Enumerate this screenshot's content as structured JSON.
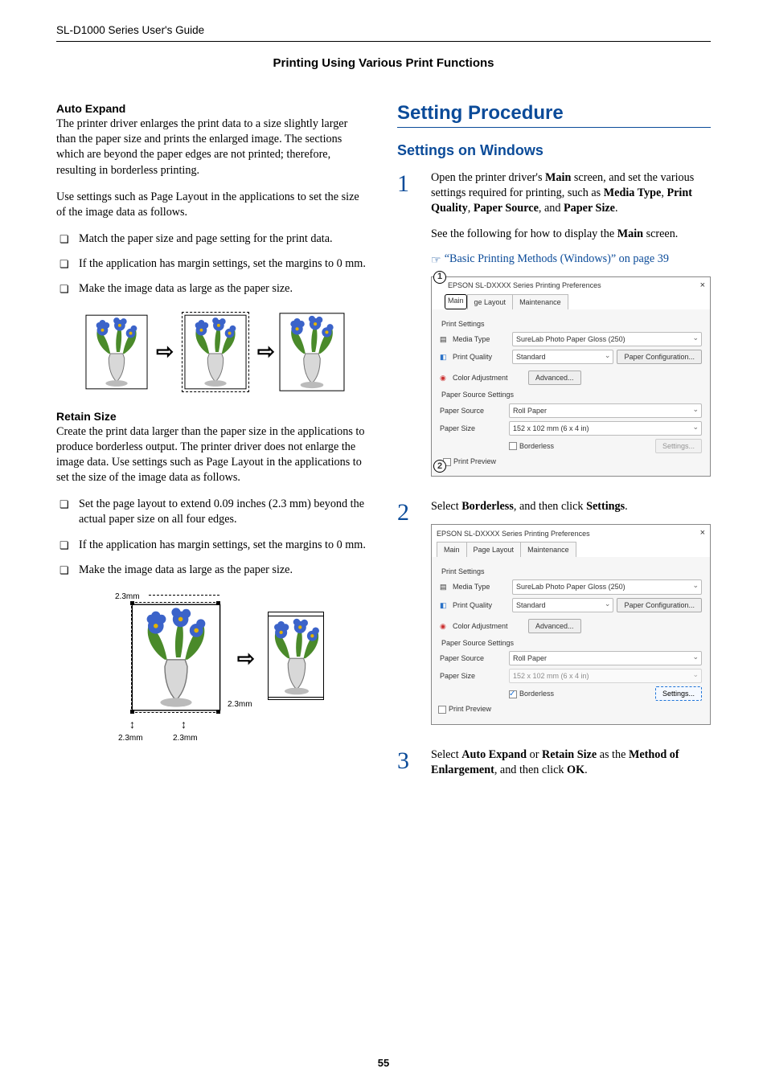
{
  "header": {
    "breadcrumb": "SL-D1000 Series User's Guide",
    "section": "Printing Using Various Print Functions"
  },
  "left": {
    "auto_head": "Auto Expand",
    "auto_body": "The printer driver enlarges the print data to a size slightly larger than the paper size and prints the enlarged image. The sections which are beyond the paper edges are not printed; therefore, resulting in borderless printing.",
    "auto_body2": "Use settings such as Page Layout in the applications to set the size of the image data as follows.",
    "auto_bullets": [
      "Match the paper size and page setting for the print data.",
      "If the application has margin settings, set the margins to 0 mm.",
      "Make the image data as large as the paper size."
    ],
    "retain_head": "Retain Size",
    "retain_body": "Create the print data larger than the paper size in the applications to produce borderless output. The printer driver does not enlarge the image data. Use settings such as Page Layout in the applications to set the size of the image data as follows.",
    "retain_bullets": [
      "Set the page layout to extend 0.09 inches (2.3 mm) beyond the actual paper size on all four edges.",
      "If the application has margin settings, set the margins to 0 mm.",
      "Make the image data as large as the paper size."
    ],
    "mm": "2.3mm"
  },
  "right": {
    "h1": "Setting Procedure",
    "h2": "Settings on Windows",
    "steps": {
      "s1a": "Open the printer driver's Main screen, and set the various settings required for printing, such as Media Type, Print Quality, Paper Source, and Paper Size.",
      "s1b": "See the following for how to display the Main screen.",
      "s1link": "“Basic Printing Methods (Windows)” on page 39",
      "s2": "Select Borderless, and then click Settings.",
      "s3": "Select Auto Expand or Retain Size as the Method of Enlargement, and then click OK."
    }
  },
  "shot": {
    "title": "EPSON SL-DXXXX Series Printing Preferences",
    "tabs": {
      "main": "Main",
      "layout": "Page Layout",
      "pglayout_short": "ge Layout",
      "maint": "Maintenance"
    },
    "groups": {
      "print": "Print Settings",
      "source": "Paper Source Settings"
    },
    "labels": {
      "media": "Media Type",
      "quality": "Print Quality",
      "coloradj": "Color Adjustment",
      "advanced": "Advanced...",
      "papersrc": "Paper Source",
      "papersize": "Paper Size",
      "borderless": "Borderless",
      "settings": "Settings...",
      "preview": "Print Preview",
      "paperconf": "Paper Configuration..."
    },
    "values": {
      "media": "SureLab Photo Paper Gloss (250)",
      "quality": "Standard",
      "papersrc": "Roll Paper",
      "papersize": "152 x 102 mm (6 x 4 in)",
      "papersize_trunc": "152 x 102 mm (6 x 4 in)"
    }
  },
  "page_number": "55"
}
